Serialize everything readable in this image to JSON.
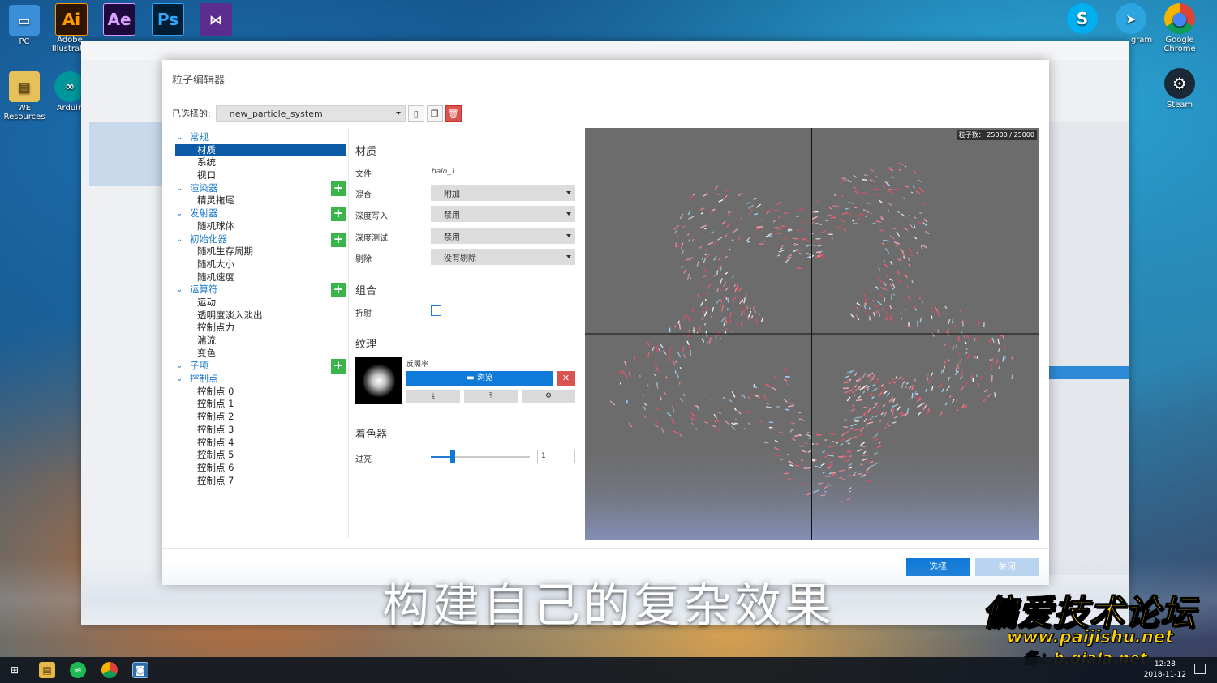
{
  "desktop": {
    "left_icons": [
      {
        "label": "PC",
        "icon": "computer-icon"
      },
      {
        "label": "Adobe Illustrato",
        "icon": "illustrator-icon"
      },
      {
        "label": "WE Resources",
        "icon": "folder-icon"
      },
      {
        "label": "Arduin",
        "icon": "arduino-icon"
      }
    ],
    "top_icons": [
      {
        "label": "Ai",
        "color": "#ff9a00",
        "bg": "#2f1400"
      },
      {
        "label": "Ae",
        "color": "#d8a2ff",
        "bg": "#1f0a3d"
      },
      {
        "label": "Ps",
        "color": "#31a8ff",
        "bg": "#001d34"
      },
      {
        "label": "VS",
        "color": "#ffffff",
        "bg": "#5c2d91"
      }
    ],
    "right_icons": [
      {
        "label": "",
        "icon": "skype-icon",
        "glyph": "S"
      },
      {
        "label": "gram",
        "icon": "telegram-icon",
        "glyph": "➤"
      },
      {
        "label": "Google Chrome",
        "icon": "chrome-icon",
        "glyph": "●"
      },
      {
        "label": "Steam",
        "icon": "steam-icon",
        "glyph": "⚙"
      }
    ]
  },
  "dialog": {
    "title": "粒子编辑器",
    "selected_label": "已选择的:",
    "selected_value": "new_particle_system"
  },
  "tree": {
    "groups": [
      {
        "label": "常规",
        "has_add": false,
        "children": [
          "材质",
          "系统",
          "视口"
        ]
      },
      {
        "label": "渲染器",
        "has_add": true,
        "children": [
          "精灵拖尾"
        ]
      },
      {
        "label": "发射器",
        "has_add": true,
        "children": [
          "随机球体"
        ]
      },
      {
        "label": "初始化器",
        "has_add": true,
        "children": [
          "随机生存周期",
          "随机大小",
          "随机速度"
        ]
      },
      {
        "label": "运算符",
        "has_add": true,
        "children": [
          "运动",
          "透明度淡入淡出",
          "控制点力",
          "湍流",
          "变色"
        ]
      },
      {
        "label": "子项",
        "has_add": true,
        "children": []
      },
      {
        "label": "控制点",
        "has_add": false,
        "children": [
          "控制点 0",
          "控制点 1",
          "控制点 2",
          "控制点 3",
          "控制点 4",
          "控制点 5",
          "控制点 6",
          "控制点 7"
        ]
      }
    ],
    "selected_item": "材质"
  },
  "props": {
    "material_title": "材质",
    "file_label": "文件",
    "file_value": "halo_1",
    "blend_label": "混合",
    "blend_value": "附加",
    "depth_write_label": "深度写入",
    "depth_write_value": "禁用",
    "depth_test_label": "深度测试",
    "depth_test_value": "禁用",
    "cull_label": "剔除",
    "cull_value": "没有剔除",
    "combine_title": "组合",
    "refract_label": "折射",
    "refract_checked": false,
    "texture_title": "纹理",
    "albedo_label": "反照率",
    "browse_label": "浏览",
    "shader_title": "着色器",
    "overbright_label": "过亮",
    "overbright_value": "1",
    "overbright_slider": 0.22
  },
  "preview": {
    "particle_count": "粒子数： 25000 / 25000"
  },
  "buttons": {
    "select": "选择",
    "close": "关闭"
  },
  "subtitle": "构建自己的复杂效果",
  "watermark": {
    "line1": "偏爱技术论坛",
    "line2": "www.paijishu.net",
    "line3": "备：b.qiala.net"
  },
  "taskbar": {
    "time": "12:28",
    "date": "2018-11-12"
  }
}
